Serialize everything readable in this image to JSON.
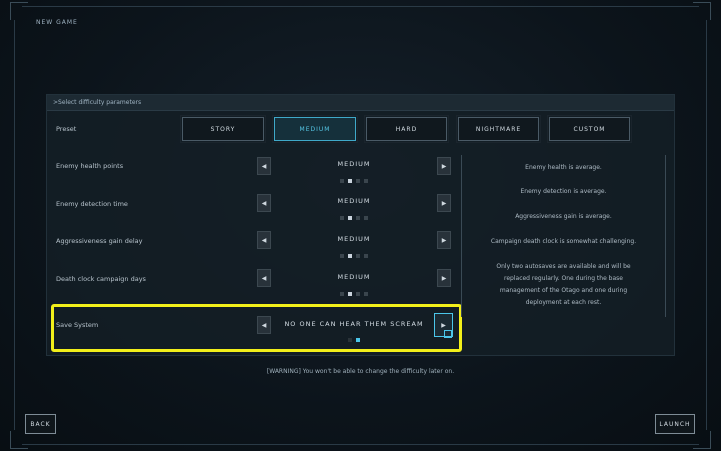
{
  "title": "NEW GAME",
  "panel_header": ">Select difficulty parameters",
  "preset": {
    "label": "Preset",
    "options": [
      "STORY",
      "MEDIUM",
      "HARD",
      "NIGHTMARE",
      "CUSTOM"
    ],
    "selected": "MEDIUM"
  },
  "rows": [
    {
      "label": "Enemy health points",
      "value": "MEDIUM"
    },
    {
      "label": "Enemy detection time",
      "value": "MEDIUM"
    },
    {
      "label": "Aggressiveness gain delay",
      "value": "MEDIUM"
    },
    {
      "label": "Death clock campaign days",
      "value": "MEDIUM"
    }
  ],
  "save_system": {
    "label": "Save System",
    "value": "NO ONE CAN HEAR THEM SCREAM"
  },
  "descriptions": [
    "Enemy health is average.",
    "Enemy detection is average.",
    "Aggressiveness gain is average.",
    "Campaign death clock is somewhat challenging.",
    "Only two autosaves are available and will be",
    "replaced regularly. One during the base",
    "management of the Otago and one during",
    "deployment at each rest."
  ],
  "warning": "[WARNING] You won't be able to change the difficulty later on.",
  "buttons": {
    "back": "BACK",
    "launch": "LAUNCH"
  },
  "icons": {
    "left_arrow": "left-arrow-icon",
    "right_arrow": "right-arrow-icon"
  },
  "colors": {
    "accent": "#4bc6ea",
    "highlight": "#f2ef1a"
  }
}
